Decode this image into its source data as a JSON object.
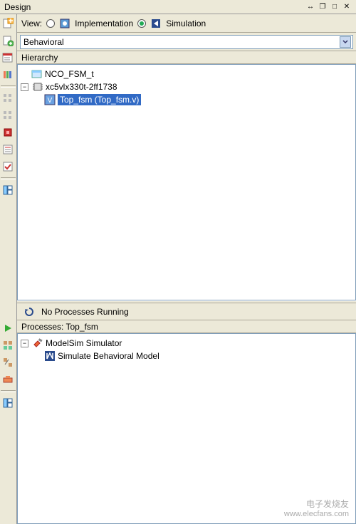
{
  "panel": {
    "title": "Design"
  },
  "view": {
    "label": "View:",
    "implementation": "Implementation",
    "simulation": "Simulation"
  },
  "dropdown": {
    "value": "Behavioral"
  },
  "hierarchy": {
    "label": "Hierarchy",
    "project": "NCO_FSM_t",
    "device": "xc5vlx330t-2ff1738",
    "module": "Top_fsm (Top_fsm.v)"
  },
  "processes": {
    "status": "No Processes Running",
    "label_prefix": "Processes: ",
    "target": "Top_fsm",
    "simulator": "ModelSim Simulator",
    "action": "Simulate Behavioral Model"
  },
  "watermark": {
    "line1": "电子发烧友",
    "line2": "www.elecfans.com"
  }
}
